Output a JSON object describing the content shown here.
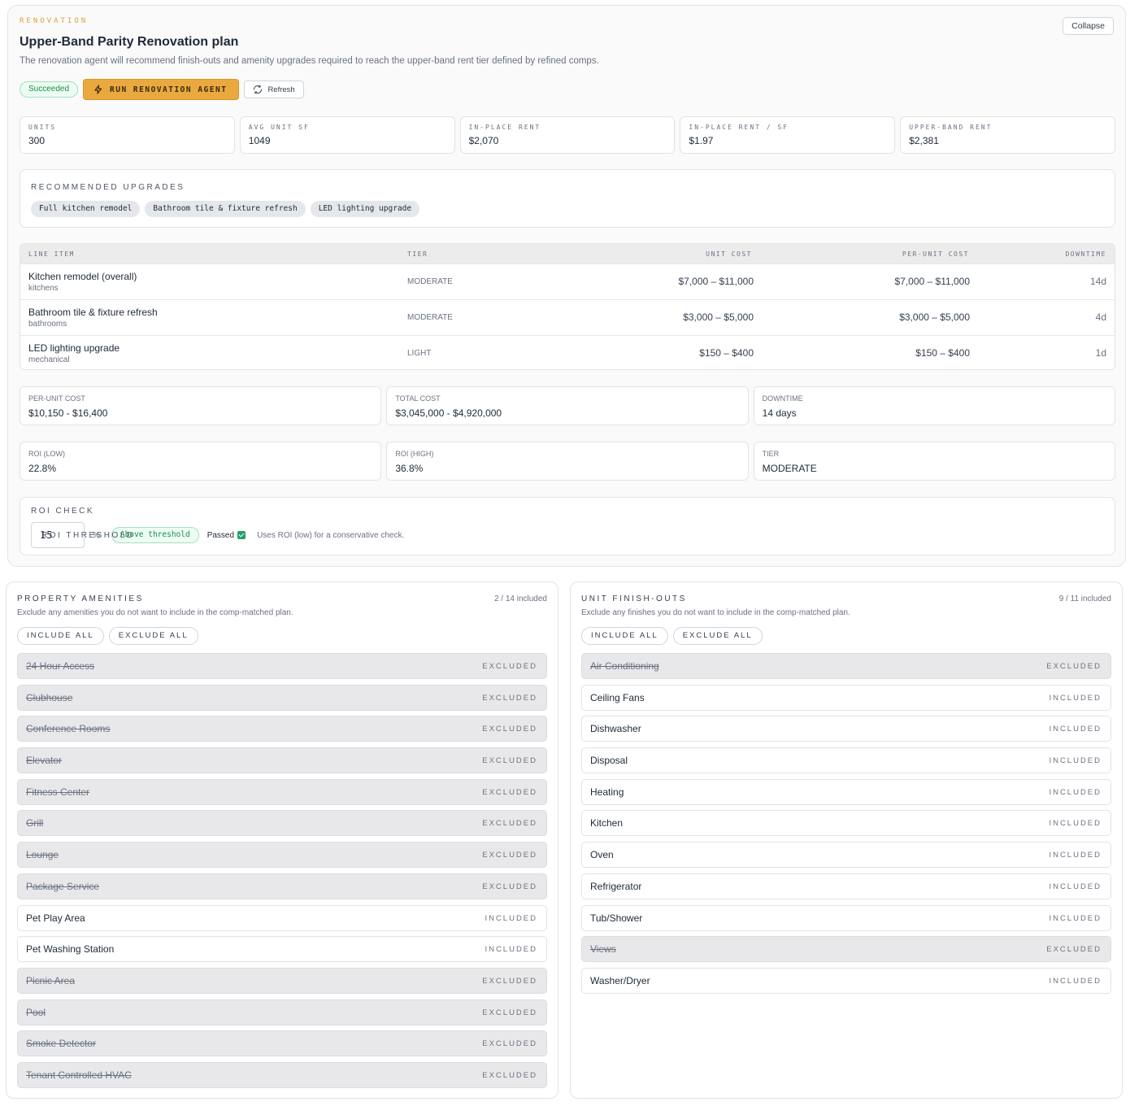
{
  "header": {
    "eyebrow": "RENOVATION",
    "title": "Upper-Band Parity Renovation plan",
    "subtitle": "The renovation agent will recommend finish-outs and amenity upgrades required to reach the upper-band rent tier defined by refined comps.",
    "collapse_label": "Collapse"
  },
  "actions": {
    "status_badge": "Succeeded",
    "run_label": "RUN RENOVATION AGENT",
    "refresh_label": "Refresh"
  },
  "metrics": [
    {
      "label": "UNITS",
      "value": "300"
    },
    {
      "label": "AVG UNIT SF",
      "value": "1049"
    },
    {
      "label": "IN-PLACE RENT",
      "value": "$2,070"
    },
    {
      "label": "IN-PLACE RENT / SF",
      "value": "$1.97"
    },
    {
      "label": "UPPER-BAND RENT",
      "value": "$2,381"
    }
  ],
  "upgrades": {
    "label": "RECOMMENDED UPGRADES",
    "chips": [
      "Full kitchen remodel",
      "Bathroom tile & fixture refresh",
      "LED lighting upgrade"
    ]
  },
  "line_items": {
    "headers": {
      "item": "LINE ITEM",
      "tier": "TIER",
      "unit_cost": "UNIT COST",
      "per_unit_cost": "PER-UNIT COST",
      "downtime": "DOWNTIME"
    },
    "rows": [
      {
        "name": "Kitchen remodel (overall)",
        "category": "kitchens",
        "tier": "MODERATE",
        "unit_cost": "$7,000 – $11,000",
        "per_unit_cost": "$7,000 – $11,000",
        "downtime": "14d"
      },
      {
        "name": "Bathroom tile & fixture refresh",
        "category": "bathrooms",
        "tier": "MODERATE",
        "unit_cost": "$3,000 – $5,000",
        "per_unit_cost": "$3,000 – $5,000",
        "downtime": "4d"
      },
      {
        "name": "LED lighting upgrade",
        "category": "mechanical",
        "tier": "LIGHT",
        "unit_cost": "$150 – $400",
        "per_unit_cost": "$150 – $400",
        "downtime": "1d"
      }
    ]
  },
  "summary_row1": [
    {
      "label": "PER-UNIT COST",
      "value": "$10,150 - $16,400"
    },
    {
      "label": "TOTAL COST",
      "value": "$3,045,000 - $4,920,000"
    },
    {
      "label": "DOWNTIME",
      "value": "14 days"
    }
  ],
  "summary_row2": [
    {
      "label": "ROI (LOW)",
      "value": "22.8%"
    },
    {
      "label": "ROI (HIGH)",
      "value": "36.8%"
    },
    {
      "label": "TIER",
      "value": "MODERATE"
    }
  ],
  "roi_check": {
    "label": "ROI CHECK",
    "threshold_label": "ROI THRESHOLD",
    "threshold_value": "15",
    "unit": "%",
    "result_badge": "Above threshold",
    "passed_label": "Passed",
    "hint": "Uses ROI (low) for a conservative check."
  },
  "amenities": {
    "title": "PROPERTY AMENITIES",
    "count": "2 / 14 included",
    "description": "Exclude any amenities you do not want to include in the comp-matched plan.",
    "include_all": "INCLUDE ALL",
    "exclude_all": "EXCLUDE ALL",
    "items": [
      {
        "name": "24 Hour Access",
        "status": "EXCLUDED"
      },
      {
        "name": "Clubhouse",
        "status": "EXCLUDED"
      },
      {
        "name": "Conference Rooms",
        "status": "EXCLUDED"
      },
      {
        "name": "Elevator",
        "status": "EXCLUDED"
      },
      {
        "name": "Fitness Center",
        "status": "EXCLUDED"
      },
      {
        "name": "Grill",
        "status": "EXCLUDED"
      },
      {
        "name": "Lounge",
        "status": "EXCLUDED"
      },
      {
        "name": "Package Service",
        "status": "EXCLUDED"
      },
      {
        "name": "Pet Play Area",
        "status": "INCLUDED"
      },
      {
        "name": "Pet Washing Station",
        "status": "INCLUDED"
      },
      {
        "name": "Picnic Area",
        "status": "EXCLUDED"
      },
      {
        "name": "Pool",
        "status": "EXCLUDED"
      },
      {
        "name": "Smoke Detector",
        "status": "EXCLUDED"
      },
      {
        "name": "Tenant Controlled HVAC",
        "status": "EXCLUDED"
      }
    ]
  },
  "finishes": {
    "title": "UNIT FINISH-OUTS",
    "count": "9 / 11 included",
    "description": "Exclude any finishes you do not want to include in the comp-matched plan.",
    "include_all": "INCLUDE ALL",
    "exclude_all": "EXCLUDE ALL",
    "items": [
      {
        "name": "Air Conditioning",
        "status": "EXCLUDED"
      },
      {
        "name": "Ceiling Fans",
        "status": "INCLUDED"
      },
      {
        "name": "Dishwasher",
        "status": "INCLUDED"
      },
      {
        "name": "Disposal",
        "status": "INCLUDED"
      },
      {
        "name": "Heating",
        "status": "INCLUDED"
      },
      {
        "name": "Kitchen",
        "status": "INCLUDED"
      },
      {
        "name": "Oven",
        "status": "INCLUDED"
      },
      {
        "name": "Refrigerator",
        "status": "INCLUDED"
      },
      {
        "name": "Tub/Shower",
        "status": "INCLUDED"
      },
      {
        "name": "Views",
        "status": "EXCLUDED"
      },
      {
        "name": "Washer/Dryer",
        "status": "INCLUDED"
      }
    ]
  }
}
